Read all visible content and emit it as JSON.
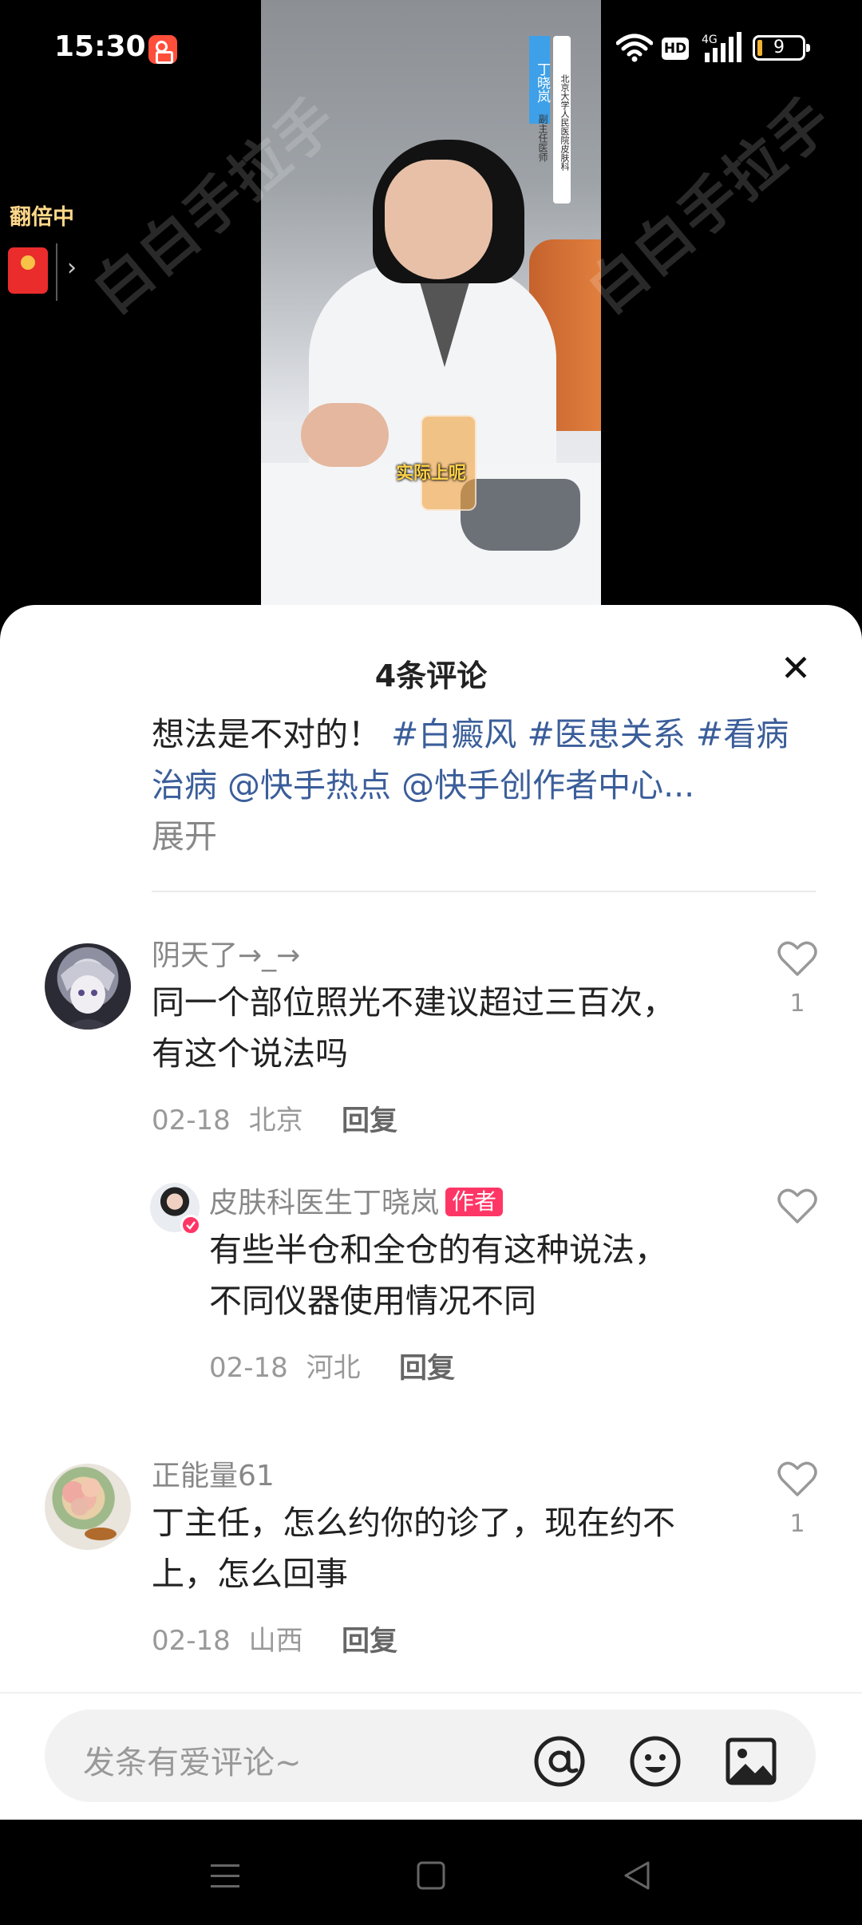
{
  "status_bar": {
    "time": "15:30",
    "network_badge": "HD",
    "network_type": "4G",
    "battery_level": "9"
  },
  "video": {
    "doctor_name": "丁晓岚",
    "doctor_title": "副主任医师",
    "hospital": "北京大学人民医院皮肤科",
    "subtitle": "实际上呢",
    "watermark": "白白手拉手"
  },
  "floating_widget": {
    "label": "翻倍中",
    "chevron": "›"
  },
  "sheet": {
    "title": "4条评论",
    "close_icon": "✕",
    "caption": {
      "text": "想法是不对的！",
      "tags": [
        "#白癜风",
        "#医患关系",
        "#看病治病",
        "@快手热点",
        "@快手创作者中心..."
      ],
      "expand": "展开"
    },
    "comments": [
      {
        "username": "阴天了→_→",
        "text": "同一个部位照光不建议超过三百次，有这个说法吗",
        "date": "02-18",
        "location": "北京",
        "reply_label": "回复",
        "likes": "1"
      },
      {
        "username": "皮肤科医生丁晓岚",
        "badge": "作者",
        "text": "有些半仓和全仓的有这种说法，不同仪器使用情况不同",
        "date": "02-18",
        "location": "河北",
        "reply_label": "回复"
      },
      {
        "username": "正能量61",
        "text": "丁主任，怎么约你的诊了，现在约不上，怎么回事",
        "date": "02-18",
        "location": "山西",
        "reply_label": "回复",
        "likes": "1"
      }
    ]
  },
  "input_bar": {
    "placeholder": "发条有爱评论~",
    "icons": [
      "at-icon",
      "emoji-icon",
      "image-icon"
    ]
  },
  "colors": {
    "tag_blue": "#3b5e9a",
    "author_badge": "#fe3666",
    "float_label": "#ffd88a"
  }
}
